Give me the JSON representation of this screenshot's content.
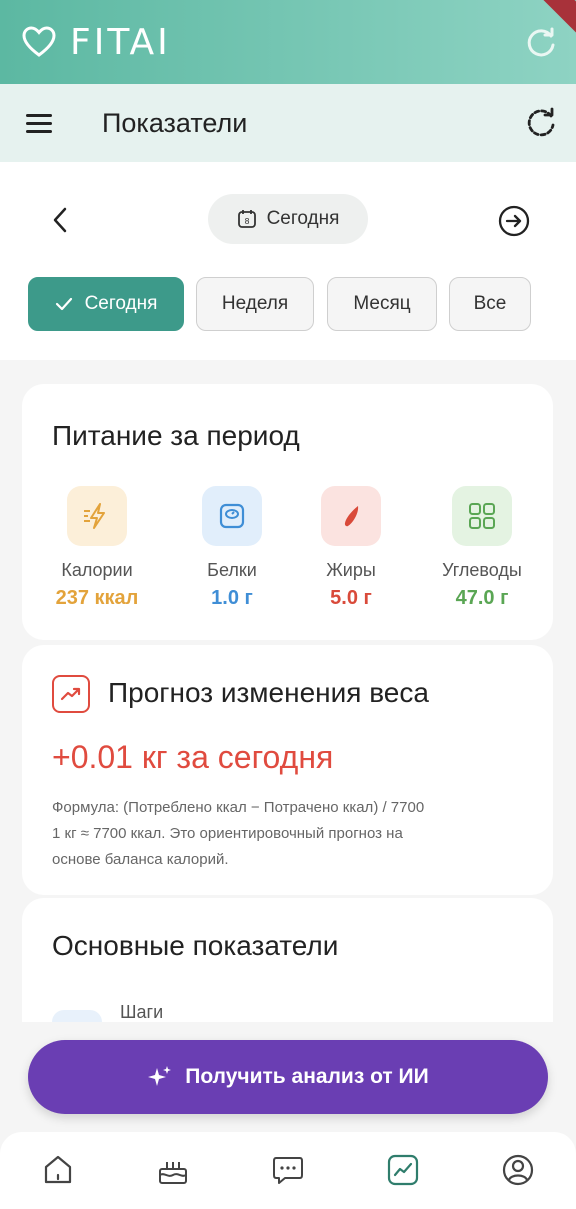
{
  "brand": {
    "name": "FITAI"
  },
  "header": {
    "title": "Показатели"
  },
  "date_nav": {
    "current": "Сегодня",
    "calendar_day": "8"
  },
  "period_tabs": [
    {
      "label": "Сегодня",
      "active": true
    },
    {
      "label": "Неделя",
      "active": false
    },
    {
      "label": "Месяц",
      "active": false
    },
    {
      "label": "Все",
      "active": false
    }
  ],
  "nutrition": {
    "title": "Питание за период",
    "items": [
      {
        "label": "Калории",
        "value": "237 ккал",
        "color": "#e3a33b",
        "icon": "lightning-icon"
      },
      {
        "label": "Белки",
        "value": "1.0 г",
        "color": "#3f8ed6",
        "icon": "scale-icon"
      },
      {
        "label": "Жиры",
        "value": "5.0 г",
        "color": "#d94a3a",
        "icon": "drop-icon"
      },
      {
        "label": "Углеводы",
        "value": "47.0 г",
        "color": "#5aa654",
        "icon": "grid-icon"
      }
    ]
  },
  "forecast": {
    "title": "Прогноз изменения веса",
    "value": "+0.01 кг за сегодня",
    "note_line1": "Формула: (Потреблено ккал − Потрачено ккал) / 7700",
    "note_line2": "1 кг ≈ 7700 ккал. Это ориентировочный прогноз на",
    "note_line3": "основе баланса калорий."
  },
  "main_metrics": {
    "title": "Основные показатели",
    "first_item_label": "Шаги"
  },
  "ai_button": {
    "label": "Получить анализ от ИИ"
  },
  "bottom_nav": [
    {
      "icon": "home-icon",
      "active": false
    },
    {
      "icon": "cake-icon",
      "active": false
    },
    {
      "icon": "chat-icon",
      "active": false
    },
    {
      "icon": "stats-icon",
      "active": true
    },
    {
      "icon": "profile-icon",
      "active": false
    }
  ],
  "colors": {
    "accent": "#3d9a8a",
    "forecast": "#e04b3f",
    "ai_button": "#6a3eb3"
  }
}
